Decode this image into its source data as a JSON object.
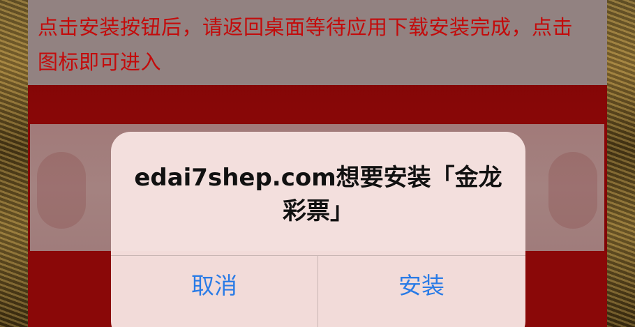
{
  "notice": {
    "text": "点击安装按钮后，请返回桌面等待应用下载安装完成，点击图标即可进入"
  },
  "alert": {
    "title": "edai7shep.com想要安装「金龙彩票」",
    "cancel_label": "取消",
    "install_label": "安装"
  },
  "colors": {
    "page_red": "#8a0707",
    "notice_bg": "#928281",
    "notice_text": "#c30b0b",
    "alert_bg": "#f6e2e0",
    "button_blue": "#2a7be6"
  }
}
